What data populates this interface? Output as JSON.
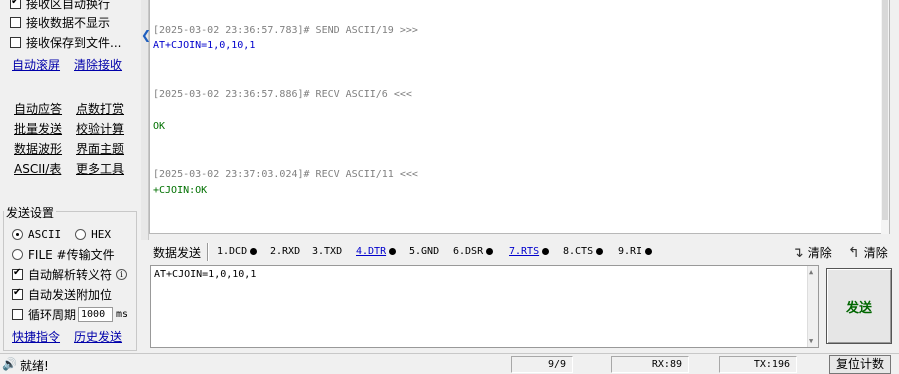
{
  "left_panel": {
    "options": {
      "auto_wrap": "接收区自动换行",
      "hide_recv": "接收数据不显示",
      "save_to_file": "接收保存到文件..."
    },
    "links": {
      "auto_scroll": "自动滚屏",
      "clear_recv": "清除接收"
    },
    "tools": [
      "自动应答",
      "点数打赏",
      "批量发送",
      "校验计算",
      "数据波形",
      "界面主题",
      "ASCII/表",
      "更多工具"
    ],
    "send_settings": {
      "title": "发送设置",
      "ascii": "ASCII",
      "hex": "HEX",
      "file": "FILE #传输文件",
      "parse_escape": "自动解析转义符",
      "append_check": "自动发送附加位",
      "cycle": "循环周期",
      "cycle_value": "1000",
      "cycle_unit": "ms",
      "shortcut": "快捷指令",
      "history": "历史发送"
    }
  },
  "log": [
    {
      "header": "[2025-03-02 23:36:57.783]# SEND ASCII/19 >>>",
      "body": "AT+CJOIN=1,0,10,1",
      "kind": "send"
    },
    {
      "header": "[2025-03-02 23:36:57.886]# RECV ASCII/6 <<<",
      "body": "OK",
      "kind": "recv"
    },
    {
      "header": "[2025-03-02 23:37:03.024]# RECV ASCII/11 <<<",
      "body": "+CJOIN:OK",
      "kind": "recv"
    }
  ],
  "toolbar": {
    "title": "数据发送",
    "signals": [
      "1.DCD",
      "2.RXD",
      "3.TXD",
      "4.DTR",
      "5.GND",
      "6.DSR",
      "7.RTS",
      "8.CTS",
      "9.RI"
    ],
    "clear_send": "清除",
    "clear_all": "清除"
  },
  "send_input": {
    "value": "AT+CJOIN=1,0,10,1",
    "send_button": "发送"
  },
  "status_bar": {
    "ready": "就绪!",
    "count": "9/9",
    "rx": "RX:89",
    "tx": "TX:196",
    "reset": "复位计数"
  }
}
